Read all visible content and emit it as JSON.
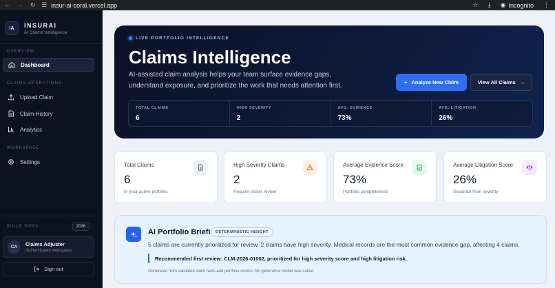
{
  "browser": {
    "url": "insur-ai-coral.vercel.app",
    "incognito_label": "Incognito"
  },
  "sidebar": {
    "logo": "IA",
    "brand": "INSURAI",
    "brand_sub": "AI Claims Intelligence",
    "sections": {
      "overview": "OVERVIEW",
      "claims_ops": "CLAIMS OPERATIONS",
      "workspace": "WORKSPACE"
    },
    "items": {
      "dashboard": "Dashboard",
      "upload": "Upload Claim",
      "history": "Claim History",
      "analytics": "Analytics",
      "settings": "Settings"
    },
    "build_week_label": "BUILD WEEK",
    "build_week_year": "2026",
    "user": {
      "initials": "CA",
      "name": "Claims Adjuster",
      "workspace": "Authenticated workspace"
    },
    "sign_out": "Sign out"
  },
  "hero": {
    "tag": "LIVE PORTFOLIO INTELLIGENCE",
    "title": "Claims Intelligence",
    "description": "AI-assisted claim analysis helps your team surface evidence gaps, understand exposure, and prioritize the work that needs attention first.",
    "analyze_button": "Analyze New Claim",
    "view_all_button": "View All Claims",
    "stats": [
      {
        "label": "TOTAL CLAIMS",
        "value": "6"
      },
      {
        "label": "HIGH SEVERITY",
        "value": "2"
      },
      {
        "label": "AVG. EVIDENCE",
        "value": "73%"
      },
      {
        "label": "AVG. LITIGATION",
        "value": "26%"
      }
    ]
  },
  "cards": [
    {
      "title": "Total Claims",
      "value": "6",
      "sub": "In your active portfolio",
      "icon": "document-icon",
      "icon_bg": "#eef1f6",
      "icon_color": "#475569"
    },
    {
      "title": "High Severity Claims",
      "value": "2",
      "sub": "Require closer review",
      "icon": "warning-icon",
      "icon_bg": "#fff1e6",
      "icon_color": "#ea580c"
    },
    {
      "title": "Average Evidence Score",
      "value": "73%",
      "sub": "Portfolio completeness",
      "icon": "check-icon",
      "icon_bg": "#e7f7ee",
      "icon_color": "#16a34a"
    },
    {
      "title": "Average Litigation Score",
      "value": "26%",
      "sub": "Separate from severity",
      "icon": "scale-icon",
      "icon_bg": "#f3ecfe",
      "icon_color": "#9333ea"
    }
  ],
  "briefing": {
    "title": "AI Portfolio Briefing",
    "badge": "DETERMINISTIC INSIGHT",
    "summary": "5 claims are currently prioritized for review. 2 claims have high severity. Medical records are the most common evidence gap, affecting 4 claims.",
    "recommendation": "Recommended first review: CLM-2026-01002, prioritized for high severity score and high litigation risk.",
    "footnote": "Generated from validated claim facts and portfolio scores. No generative model was called."
  }
}
